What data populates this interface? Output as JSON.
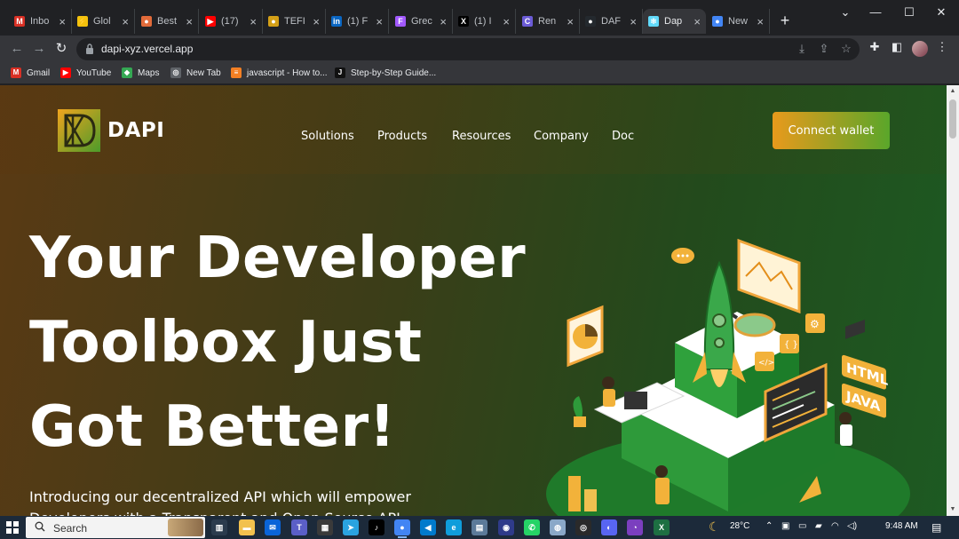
{
  "browser": {
    "tabs": [
      {
        "title": "Inbo",
        "icon": "gmail-icon",
        "color": "#d93025",
        "glyph": "M"
      },
      {
        "title": "Glol",
        "icon": "bolt-icon",
        "color": "#f4c20d",
        "glyph": "⚡"
      },
      {
        "title": "Best",
        "icon": "palette-icon",
        "color": "#e26b3a",
        "glyph": "●"
      },
      {
        "title": "(17)",
        "icon": "youtube-icon",
        "color": "#ff0000",
        "glyph": "▶"
      },
      {
        "title": "TEFI",
        "icon": "coin-icon",
        "color": "#d4a017",
        "glyph": "●"
      },
      {
        "title": "(1) F",
        "icon": "linkedin-icon",
        "color": "#0a66c2",
        "glyph": "in"
      },
      {
        "title": "Grec",
        "icon": "figma-icon",
        "color": "#a259ff",
        "glyph": "F"
      },
      {
        "title": "(1) I",
        "icon": "x-icon",
        "color": "#000000",
        "glyph": "X"
      },
      {
        "title": "Ren",
        "icon": "render-icon",
        "color": "#6b5bd6",
        "glyph": "C"
      },
      {
        "title": "DAF",
        "icon": "github-icon",
        "color": "#24292e",
        "glyph": "●"
      },
      {
        "title": "Dap",
        "icon": "react-icon",
        "color": "#61dafb",
        "glyph": "⚛"
      },
      {
        "title": "New",
        "icon": "chrome-icon",
        "color": "#4285f4",
        "glyph": "●"
      }
    ],
    "active_tab": 10,
    "url": "dapi-xyz.vercel.app",
    "bookmarks": [
      {
        "label": "Gmail",
        "icon": "gmail-icon",
        "color": "#d93025",
        "glyph": "M"
      },
      {
        "label": "YouTube",
        "icon": "youtube-icon",
        "color": "#ff0000",
        "glyph": "▶"
      },
      {
        "label": "Maps",
        "icon": "maps-icon",
        "color": "#34a853",
        "glyph": "◆"
      },
      {
        "label": "New Tab",
        "icon": "globe-icon",
        "color": "#5f6368",
        "glyph": "◎"
      },
      {
        "label": "javascript - How to...",
        "icon": "stackoverflow-icon",
        "color": "#f48024",
        "glyph": "≡"
      },
      {
        "label": "Step-by-Step Guide...",
        "icon": "notion-icon",
        "color": "#111111",
        "glyph": "J"
      }
    ]
  },
  "site": {
    "brand": "DAPI",
    "menu": [
      "Solutions",
      "Products",
      "Resources",
      "Company",
      "Doc"
    ],
    "connect_label": "Connect wallet",
    "hero_lines": [
      "Your Developer",
      "Toolbox Just",
      "Got Better!"
    ],
    "hero_sub": "Introducing our decentralized API which will empower Developers with a Transparent and Open Source API Infrastructure",
    "illustration_labels": [
      "HTML",
      "JAVA"
    ],
    "colors": {
      "accent_orange": "#e89a1c",
      "accent_green": "#5aa62a"
    }
  },
  "taskbar": {
    "search_placeholder": "Search",
    "apps": [
      {
        "icon": "task-view-icon",
        "color": "#2b3b4d",
        "glyph": "▥"
      },
      {
        "icon": "file-explorer-icon",
        "color": "#f2c14e",
        "glyph": "▬"
      },
      {
        "icon": "mail-icon",
        "color": "#0a64d8",
        "glyph": "✉"
      },
      {
        "icon": "teams-icon",
        "color": "#5b5fc7",
        "glyph": "T"
      },
      {
        "icon": "store-icon",
        "color": "#3a3a3a",
        "glyph": "▦"
      },
      {
        "icon": "telegram-icon",
        "color": "#2aa3e0",
        "glyph": "➤"
      },
      {
        "icon": "tiktok-icon",
        "color": "#000000",
        "glyph": "♪"
      },
      {
        "icon": "chrome-icon",
        "color": "#4285f4",
        "glyph": "●"
      },
      {
        "icon": "vscode-icon",
        "color": "#007acc",
        "glyph": "◀"
      },
      {
        "icon": "edge-icon",
        "color": "#0f9ddb",
        "glyph": "e"
      },
      {
        "icon": "notepad-icon",
        "color": "#5c7a99",
        "glyph": "▤"
      },
      {
        "icon": "app-icon",
        "color": "#2f3b8a",
        "glyph": "◉"
      },
      {
        "icon": "whatsapp-icon",
        "color": "#25d366",
        "glyph": "✆"
      },
      {
        "icon": "photos-icon",
        "color": "#8aa8c8",
        "glyph": "◍"
      },
      {
        "icon": "obs-icon",
        "color": "#2a2a2a",
        "glyph": "◎"
      },
      {
        "icon": "discord-icon",
        "color": "#5865f2",
        "glyph": "◐"
      },
      {
        "icon": "github-desktop-icon",
        "color": "#7b3fbf",
        "glyph": "◔"
      },
      {
        "icon": "excel-icon",
        "color": "#1d6f42",
        "glyph": "X"
      }
    ],
    "active_app": 7,
    "weather": "28°C",
    "time": "9:48 AM"
  }
}
